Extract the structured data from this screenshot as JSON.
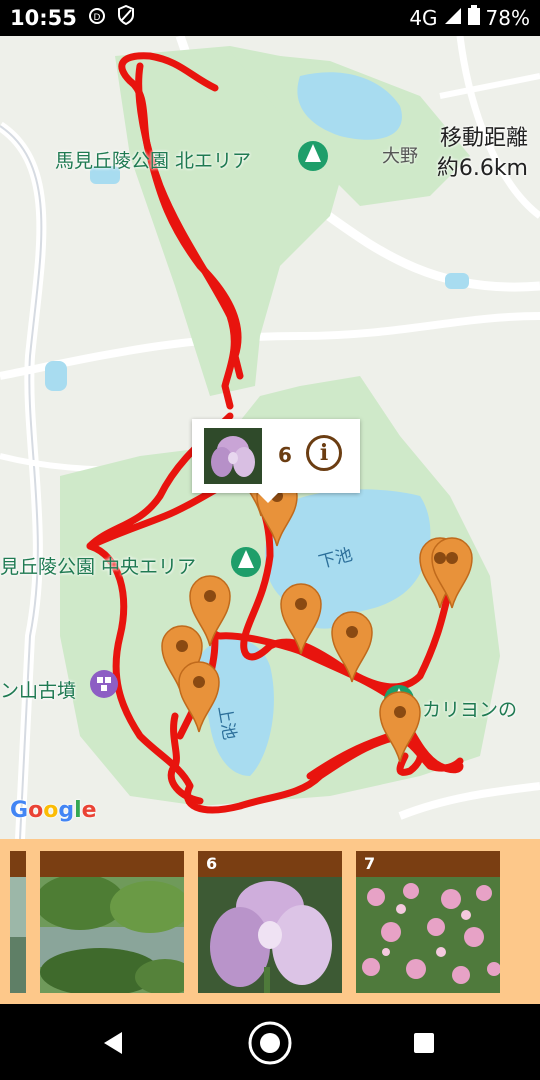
{
  "status_bar": {
    "time": "10:55",
    "network": "4G",
    "battery": "78%",
    "icons": [
      "data-saver-icon",
      "shield-icon",
      "signal-icon",
      "battery-icon"
    ]
  },
  "map": {
    "labels": {
      "north_area": "馬見丘陵公園 北エリア",
      "central_area": "見丘陵公園 中央エリア",
      "tomb": "ン山古墳",
      "carillon": "カリヨンの",
      "lower_pond": "下池",
      "upper_pond": "上池",
      "town": "大野"
    },
    "distance_title": "移動距離",
    "distance_value": "約6.6km",
    "attribution": "Google",
    "route_color": "#e8140e",
    "marker_color": "#e8923a",
    "park_color": "#cfe9c9",
    "water_color": "#a8dcf0"
  },
  "callout": {
    "photo_number": "6",
    "thumbnail": "iris-flower-photo"
  },
  "photo_strip": {
    "cards": [
      {
        "number": "",
        "thumbnail": "partial-photo"
      },
      {
        "number": "",
        "thumbnail": "pond-trees-photo"
      },
      {
        "number": "6",
        "thumbnail": "iris-flower-photo"
      },
      {
        "number": "7",
        "thumbnail": "pink-flowers-photo"
      }
    ]
  },
  "nav_bar": {
    "icons": [
      "back-icon",
      "home-icon",
      "recents-icon"
    ]
  }
}
